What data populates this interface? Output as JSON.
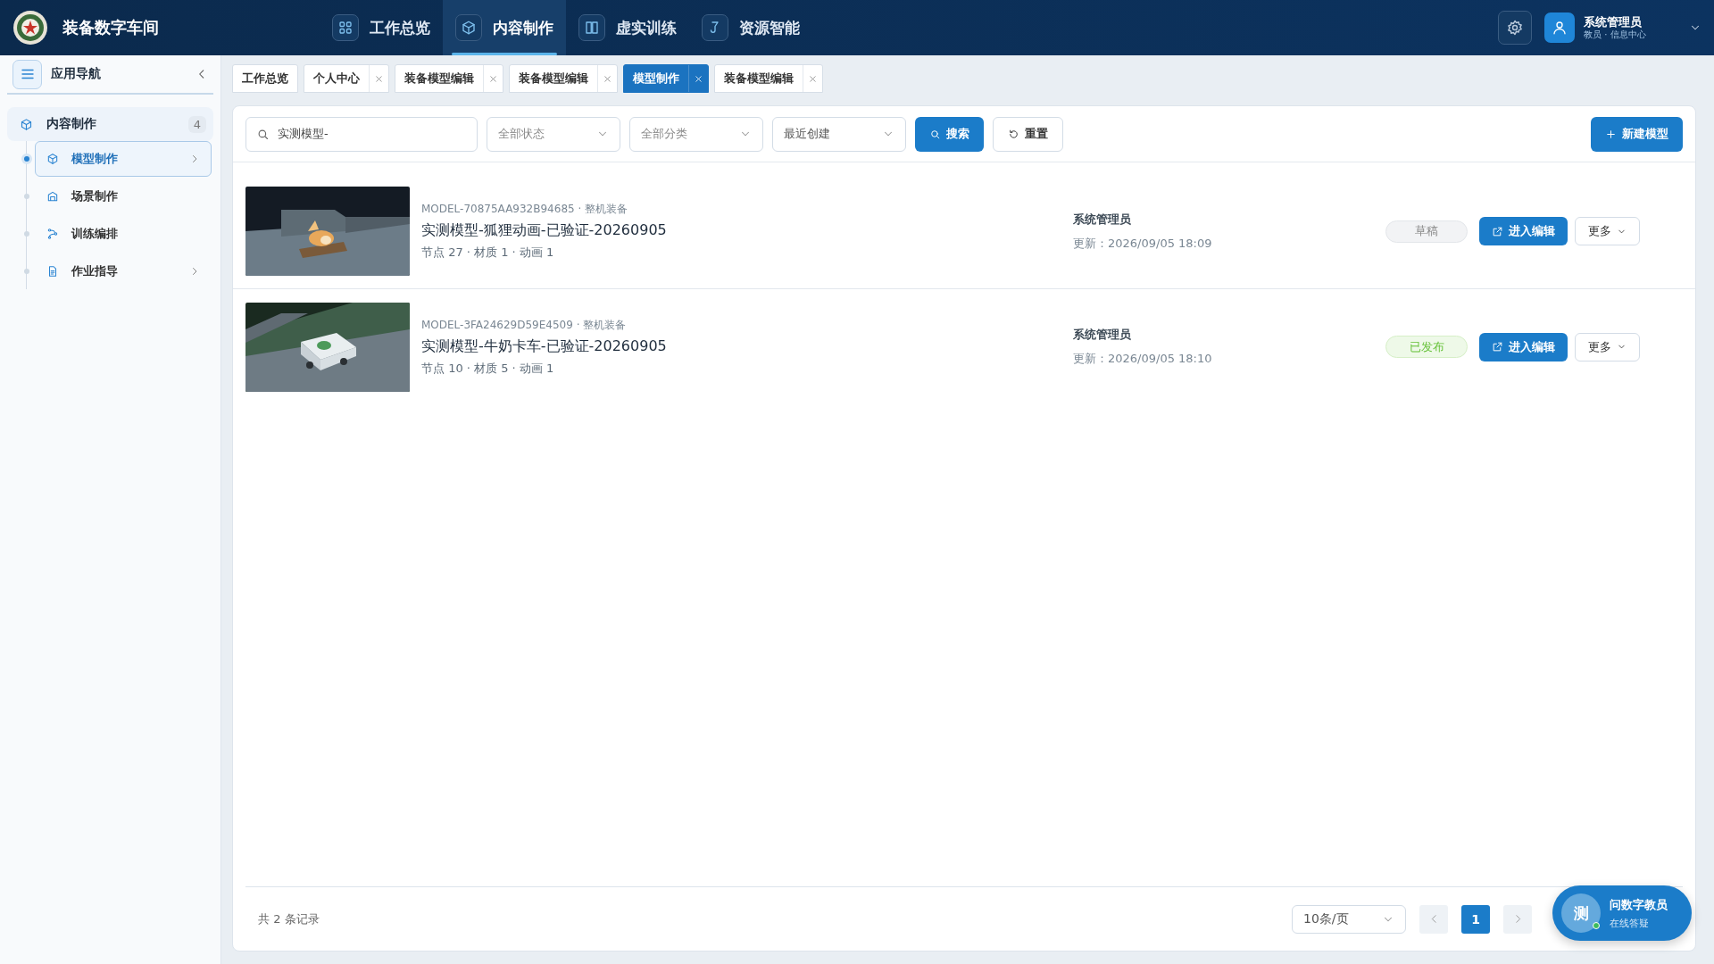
{
  "header": {
    "title": "装备数字车间",
    "nav": [
      {
        "label": "工作总览",
        "selected": false
      },
      {
        "label": "内容制作",
        "selected": true
      },
      {
        "label": "虚实训练",
        "selected": false
      },
      {
        "label": "资源智能",
        "selected": false
      }
    ],
    "user": {
      "name": "系统管理员",
      "role": "教员 · 信息中心"
    }
  },
  "sidebar": {
    "title": "应用导航",
    "group": {
      "label": "内容制作",
      "count": "4",
      "children": [
        {
          "label": "模型制作",
          "selected": true,
          "has_arrow": true
        },
        {
          "label": "场景制作",
          "selected": false,
          "has_arrow": false
        },
        {
          "label": "训练编排",
          "selected": false,
          "has_arrow": false
        },
        {
          "label": "作业指导",
          "selected": false,
          "has_arrow": true
        }
      ]
    }
  },
  "tabs": [
    {
      "label": "工作总览",
      "closable": false,
      "selected": false
    },
    {
      "label": "个人中心",
      "closable": true,
      "selected": false
    },
    {
      "label": "装备模型编辑",
      "closable": true,
      "selected": false
    },
    {
      "label": "装备模型编辑",
      "closable": true,
      "selected": false
    },
    {
      "label": "模型制作",
      "closable": true,
      "selected": true
    },
    {
      "label": "装备模型编辑",
      "closable": true,
      "selected": false
    }
  ],
  "filters": {
    "search": {
      "value": "实测模型-"
    },
    "selects": [
      "全部状态",
      "全部分类",
      "最近创建"
    ],
    "search_button": "搜索",
    "reset_button": "重置",
    "new_button": "新建模型"
  },
  "models": [
    {
      "code": "MODEL-70875AA932B94685 · 整机装备",
      "name": "实测模型-狐狸动画-已验证-20260905",
      "stats": "节点 27 · 材质 1 · 动画 1",
      "owner": "系统管理员",
      "updated": "更新：2026/09/05 18:09",
      "status": {
        "label": "草稿",
        "kind": "draft"
      },
      "edit": "进入编辑",
      "more": "更多"
    },
    {
      "code": "MODEL-3FA24629D59E4509 · 整机装备",
      "name": "实测模型-牛奶卡车-已验证-20260905",
      "stats": "节点 10 · 材质 5 · 动画 1",
      "owner": "系统管理员",
      "updated": "更新：2026/09/05 18:10",
      "status": {
        "label": "已发布",
        "kind": "published"
      },
      "edit": "进入编辑",
      "more": "更多"
    }
  ],
  "footer": {
    "total": "共 2 条记录",
    "page_size": "10条/页",
    "pages": [
      {
        "label": "1",
        "selected": true
      }
    ]
  },
  "assistant": {
    "avatar": "测",
    "title": "问数字教员",
    "subtitle": "在线答疑"
  }
}
